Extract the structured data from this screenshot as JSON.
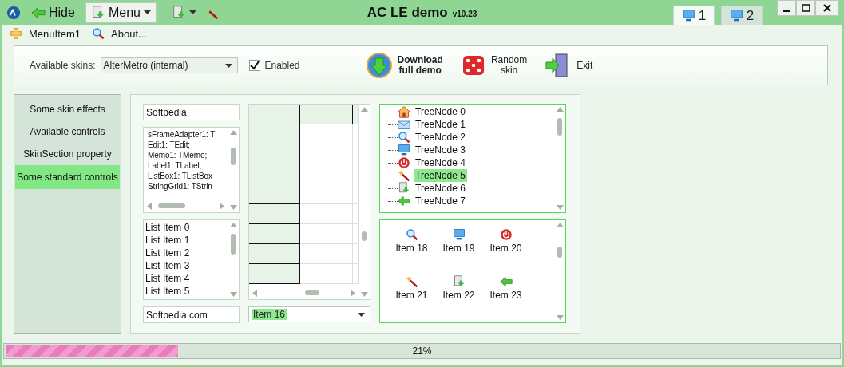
{
  "window": {
    "title": "AC LE demo",
    "version": "v10.23"
  },
  "quick_buttons": [
    {
      "kind": "hide",
      "label": "Hide"
    },
    {
      "kind": "menu",
      "label": "Menu"
    },
    {
      "kind": "document-dropdown"
    },
    {
      "kind": "wand"
    }
  ],
  "desktop_tabs": [
    {
      "label": "1",
      "selected": true
    },
    {
      "label": "2",
      "selected": false
    }
  ],
  "menu": [
    {
      "kind": "plus",
      "label": "MenuItem1"
    },
    {
      "kind": "search",
      "label": "About..."
    }
  ],
  "skin_bar": {
    "skins_label": "Available skins:",
    "skin": "AlterMetro (internal)",
    "enabled": {
      "label": "Enabled",
      "checked": true
    },
    "actions": [
      {
        "kind": "download",
        "lines": [
          "Download",
          "full demo"
        ]
      },
      {
        "kind": "dice",
        "lines": [
          "Random",
          "skin"
        ]
      },
      {
        "kind": "exit",
        "lines": [
          "Exit"
        ]
      }
    ]
  },
  "sidebar": {
    "items": [
      {
        "label": "Some skin effects",
        "selected": false
      },
      {
        "label": "Available controls",
        "selected": false
      },
      {
        "label": "SkinSection property",
        "selected": false
      },
      {
        "label": "Some standard controls",
        "selected": true
      }
    ]
  },
  "controls": {
    "edit": "Softpedia",
    "memo_lines": [
      "sFrameAdapter1: T",
      "Edit1: TEdit;",
      "Memo1: TMemo;",
      "Label1: TLabel;",
      "ListBox1: TListBox",
      "StringGrid1: TStrin"
    ],
    "list_items": [
      "List Item 0",
      "List Item 1",
      "List Item 2",
      "List Item 3",
      "List Item 4",
      "List Item 5"
    ],
    "edit2": "Softpedia.com",
    "combo": "Item 16",
    "tree": [
      {
        "kind": "house",
        "label": "TreeNode 0",
        "selected": false
      },
      {
        "kind": "mail",
        "label": "TreeNode 1",
        "selected": false
      },
      {
        "kind": "search",
        "label": "TreeNode 2",
        "selected": false
      },
      {
        "kind": "monitor",
        "label": "TreeNode 3",
        "selected": false
      },
      {
        "kind": "power",
        "label": "TreeNode 4",
        "selected": false
      },
      {
        "kind": "wand",
        "label": "TreeNode 5",
        "selected": true
      },
      {
        "kind": "document",
        "label": "TreeNode 6",
        "selected": false
      },
      {
        "kind": "arrow",
        "label": "TreeNode 7",
        "selected": false
      }
    ],
    "icon_items": [
      {
        "kind": "search",
        "label": "Item 18"
      },
      {
        "kind": "monitor",
        "label": "Item 19"
      },
      {
        "kind": "power",
        "label": "Item 20"
      },
      {
        "kind": "wand",
        "label": "Item 21"
      },
      {
        "kind": "document",
        "label": "Item 22"
      },
      {
        "kind": "arrow",
        "label": "Item 23"
      }
    ]
  },
  "progress": {
    "level": 0.21,
    "reading": "21%"
  }
}
